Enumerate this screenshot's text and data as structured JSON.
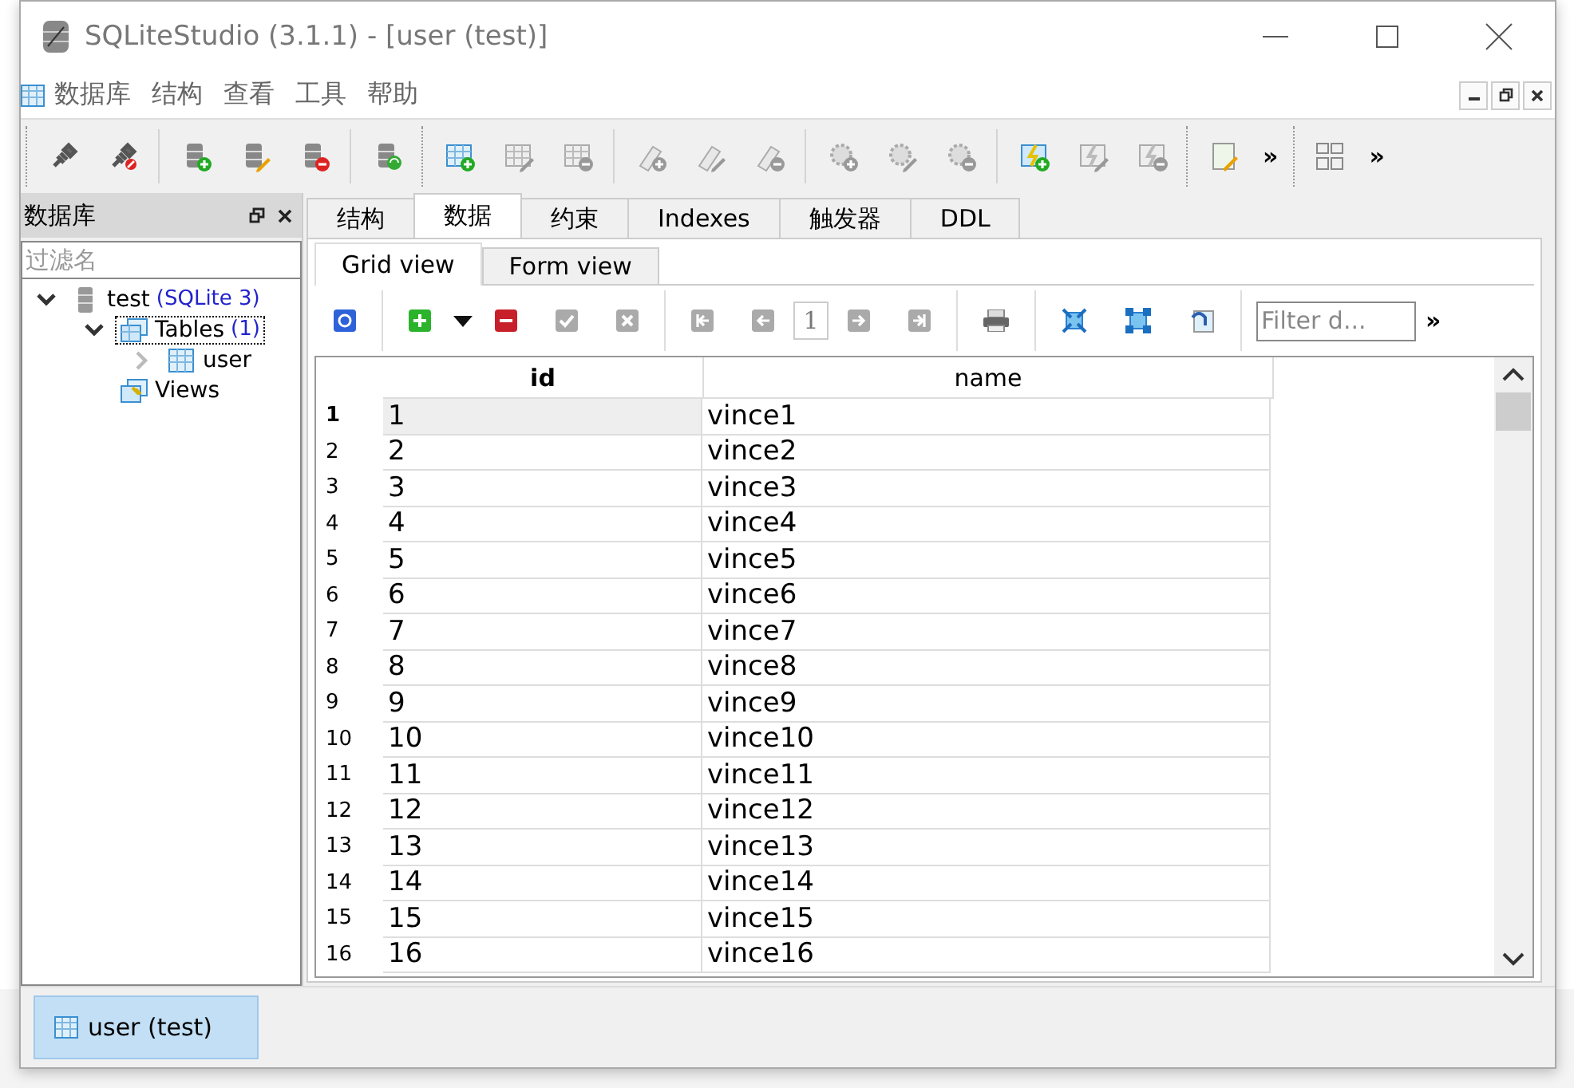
{
  "window": {
    "title": "SQLiteStudio (3.1.1) - [user (test)]"
  },
  "menu": [
    "数据库",
    "结构",
    "查看",
    "工具",
    "帮助"
  ],
  "toolbar_overflow": [
    "»",
    "»"
  ],
  "db_panel": {
    "title": "数据库",
    "filter": {
      "placeholder": "过滤名"
    },
    "tree": [
      {
        "label": "test",
        "note": "(SQLite 3)",
        "kind": "database",
        "expanded": true,
        "selected": false,
        "children": [
          {
            "label": "Tables",
            "note": "(1)",
            "kind": "tables",
            "expanded": true,
            "selected": true,
            "children": [
              {
                "label": "user",
                "kind": "table",
                "expanded": false,
                "selected": false
              }
            ]
          },
          {
            "label": "Views",
            "kind": "views",
            "selected": false
          }
        ]
      }
    ]
  },
  "tabs": [
    {
      "label": "结构",
      "selected": false
    },
    {
      "label": "数据",
      "selected": true
    },
    {
      "label": "约束",
      "selected": false
    },
    {
      "label": "Indexes",
      "selected": false
    },
    {
      "label": "触发器",
      "selected": false
    },
    {
      "label": "DDL",
      "selected": false
    }
  ],
  "view_tabs": [
    {
      "label": "Grid view",
      "selected": true
    },
    {
      "label": "Form view",
      "selected": false
    }
  ],
  "data_toolbar": {
    "page": "1",
    "filter": {
      "placeholder": "Filter d..."
    },
    "overflow": "»"
  },
  "grid": {
    "columns": [
      "id",
      "name"
    ],
    "rows": [
      {
        "number": "1",
        "id": "1",
        "name": "vince1",
        "selected": true
      },
      {
        "number": "2",
        "id": "2",
        "name": "vince2",
        "selected": false
      },
      {
        "number": "3",
        "id": "3",
        "name": "vince3",
        "selected": false
      },
      {
        "number": "4",
        "id": "4",
        "name": "vince4",
        "selected": false
      },
      {
        "number": "5",
        "id": "5",
        "name": "vince5",
        "selected": false
      },
      {
        "number": "6",
        "id": "6",
        "name": "vince6",
        "selected": false
      },
      {
        "number": "7",
        "id": "7",
        "name": "vince7",
        "selected": false
      },
      {
        "number": "8",
        "id": "8",
        "name": "vince8",
        "selected": false
      },
      {
        "number": "9",
        "id": "9",
        "name": "vince9",
        "selected": false
      },
      {
        "number": "10",
        "id": "10",
        "name": "vince10",
        "selected": false
      },
      {
        "number": "11",
        "id": "11",
        "name": "vince11",
        "selected": false
      },
      {
        "number": "12",
        "id": "12",
        "name": "vince12",
        "selected": false
      },
      {
        "number": "13",
        "id": "13",
        "name": "vince13",
        "selected": false
      },
      {
        "number": "14",
        "id": "14",
        "name": "vince14",
        "selected": false
      },
      {
        "number": "15",
        "id": "15",
        "name": "vince15",
        "selected": false
      },
      {
        "number": "16",
        "id": "16",
        "name": "vince16",
        "selected": false
      }
    ]
  },
  "taskbar": [
    {
      "label": "user (test)",
      "selected": true
    }
  ]
}
